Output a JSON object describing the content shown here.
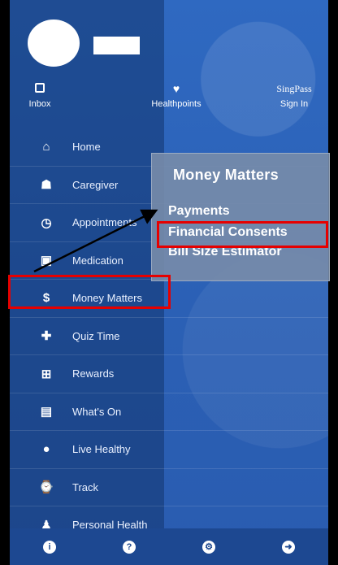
{
  "header": {
    "inbox_label": "Inbox",
    "healthpoints_label": "Healthpoints",
    "singpass_brand": "SingPass",
    "singpass_label": "Sign In"
  },
  "menu": {
    "items": [
      {
        "label": "Home",
        "icon": "home-icon"
      },
      {
        "label": "Caregiver",
        "icon": "caregiver-icon"
      },
      {
        "label": "Appointments",
        "icon": "clock-icon"
      },
      {
        "label": "Medication",
        "icon": "medication-icon"
      },
      {
        "label": "Money Matters",
        "icon": "dollar-icon"
      },
      {
        "label": "Quiz Time",
        "icon": "puzzle-icon"
      },
      {
        "label": "Rewards",
        "icon": "gift-icon"
      },
      {
        "label": "What's On",
        "icon": "calendar-icon"
      },
      {
        "label": "Live Healthy",
        "icon": "apple-icon"
      },
      {
        "label": "Track",
        "icon": "watch-icon"
      },
      {
        "label": "Personal Health",
        "icon": "person-icon"
      }
    ]
  },
  "popup": {
    "title": "Money Matters",
    "items": [
      "Payments",
      "Financial Consents",
      "Bill Size Estimator"
    ]
  },
  "footer": {
    "icons": [
      "info-icon",
      "help-icon",
      "settings-icon",
      "logout-icon"
    ]
  },
  "colors": {
    "background": "#2c63b8",
    "highlight": "#e60000",
    "footer": "#1d4891"
  }
}
